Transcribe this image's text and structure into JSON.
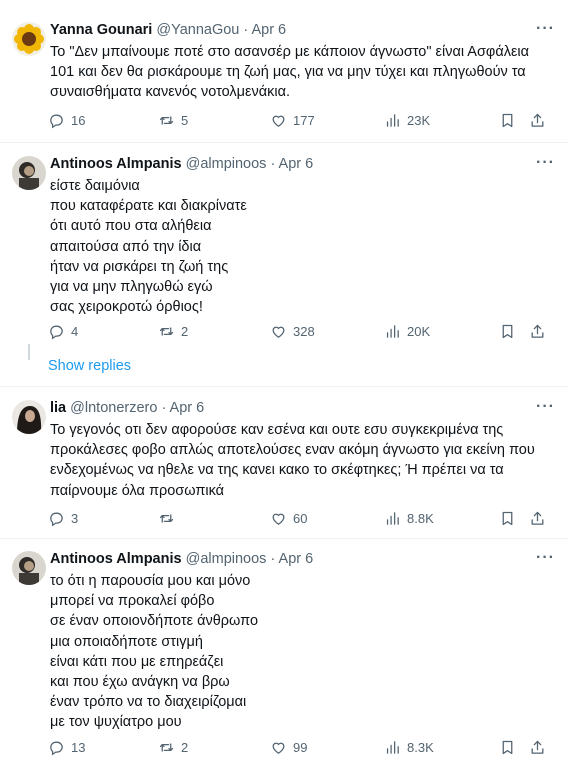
{
  "tweets": [
    {
      "name": "Yanna Gounari",
      "handle": "@YannaGou",
      "date": "Apr 6",
      "more": "···",
      "lines": [
        "Το \"Δεν μπαίνουμε ποτέ στο ασανσέρ με κάποιον άγνωστο\" είναι Ασφάλεια",
        "101 και δεν θα ρισκάρουμε τη ζωή μας, για να μην τύχει και πληγωθούν τα",
        "συναισθήματα κανενός νοτολμενάκια."
      ],
      "replies": "16",
      "retweets": "5",
      "likes": "177",
      "views": "23K"
    },
    {
      "name": "Antinoos Almpanis",
      "handle": "@almpinoos",
      "date": "Apr 6",
      "more": "···",
      "lines": [
        "είστε δαιμόνια",
        "που καταφέρατε και διακρίνατε",
        "ότι αυτό που στα αλήθεια",
        "απαιτούσα από την ίδια",
        "ήταν να ρισκάρει τη ζωή της",
        "για να μην πληγωθώ εγώ",
        "σας χειροκροτώ όρθιος!"
      ],
      "replies": "4",
      "retweets": "2",
      "likes": "328",
      "views": "20K"
    },
    {
      "name": "lia",
      "handle": "@lntonerzero",
      "date": "Apr 6",
      "more": "···",
      "lines": [
        "Το γεγονός οτι δεν αφορούσε καν εσένα και ουτε εσυ συγκεκριμένα της",
        "προκάλεσες φοβο απλώς αποτελούσες εναν ακόμη άγνωστο για εκείνη που",
        "ενδεχομένως να ηθελε να της κανει κακο το σκέφτηκες; Ή πρέπει να τα",
        "παίρνουμε όλα προσωπικά"
      ],
      "replies": "3",
      "retweets": "",
      "likes": "60",
      "views": "8.8K"
    },
    {
      "name": "Antinoos Almpanis",
      "handle": "@almpinoos",
      "date": "Apr 6",
      "more": "···",
      "lines": [
        "το ότι η παρουσία μου και μόνο",
        "μπορεί να προκαλεί φόβο",
        "σε έναν οποιονδήποτε άνθρωπο",
        "μια οποιαδήποτε στιγμή",
        "είναι κάτι που με επηρεάζει",
        "και που έχω ανάγκη να βρω",
        "έναν τρόπο να το διαχειρίζομαι",
        "με τον ψυχίατρο μου"
      ],
      "replies": "13",
      "retweets": "2",
      "likes": "99",
      "views": "8.3K"
    }
  ],
  "show_replies": "Show replies",
  "icons": {
    "reply": "reply-icon",
    "retweet": "retweet-icon",
    "like": "like-icon",
    "views": "views-icon",
    "bookmark": "bookmark-icon",
    "share": "share-icon"
  },
  "colors": {
    "text": "#0f1419",
    "muted": "#536471",
    "link": "#1d9bf0",
    "divider": "#eff3f4",
    "thread_line": "#cfd9de"
  }
}
